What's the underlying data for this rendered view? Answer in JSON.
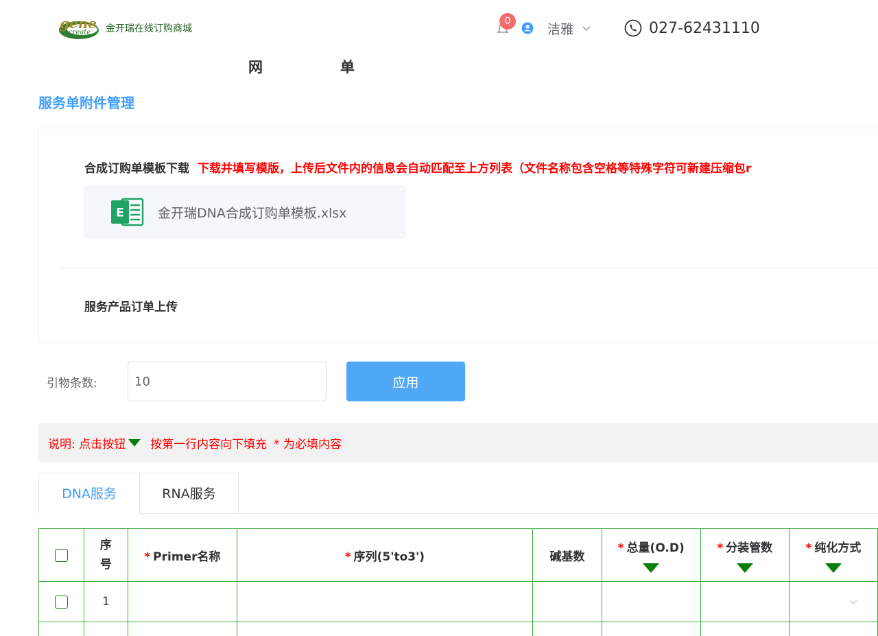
{
  "header": {
    "logo_text": "gene create",
    "site_name": "金开瑞在线订购商城",
    "notification_count": "0",
    "user_name": "洁雅",
    "phone": "027-62431110"
  },
  "page": {
    "title_char_1": "网",
    "title_char_2": "单",
    "section_title": "服务单附件管理"
  },
  "attachment": {
    "template_label": "合成订购单模板下载",
    "template_hint": "下载并填写模版，上传后文件内的信息会自动匹配至上方列表（文件名称包含空格等特殊字符可新建压缩包r",
    "file_name": "金开瑞DNA合成订购单模板.xlsx",
    "upload_label": "服务产品订单上传"
  },
  "primer_count": {
    "label": "引物条数:",
    "value": "10",
    "apply_label": "应用"
  },
  "notice": {
    "part1": "说明: 点击按钮",
    "part2": "按第一行内容向下填充",
    "part3": "* 为必填内容"
  },
  "tabs": [
    {
      "label": "DNA服务",
      "active": true
    },
    {
      "label": "RNA服务",
      "active": false
    }
  ],
  "table": {
    "columns": {
      "index": "序号",
      "primer_name": "Primer名称",
      "sequence": "序列(5'to3')",
      "base_count": "碱基数",
      "total_od": "总量(O.D)",
      "tube_count": "分装管数",
      "purification": "纯化方式"
    },
    "required_mark": "*",
    "rows": [
      {
        "index": "1"
      },
      {
        "index": ""
      }
    ]
  },
  "colors": {
    "accent": "#409eff",
    "button": "#4fa8f6",
    "table_border": "#3cab3c",
    "fill_down_arrow": "#0a7d0a",
    "warning_text": "#ff0000"
  }
}
